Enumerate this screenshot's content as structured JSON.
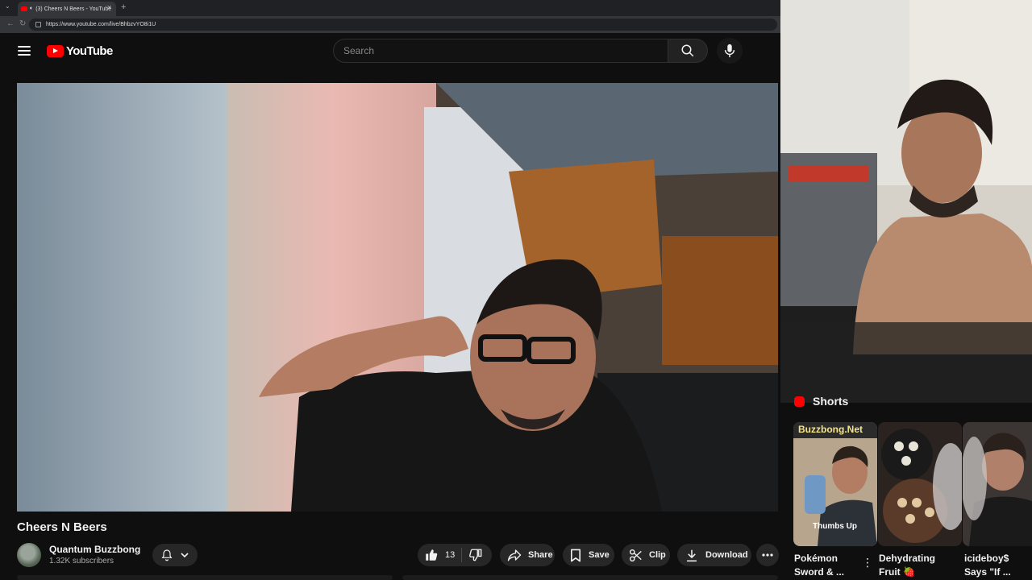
{
  "browser": {
    "tab_title": "(3) Cheers N Beers - YouTube",
    "url": "https://www.youtube.com/live/BhbzvYO8i1U"
  },
  "header": {
    "logo_text": "YouTube",
    "search_placeholder": "Search"
  },
  "video": {
    "title": "Cheers N Beers"
  },
  "channel": {
    "name": "Quantum Buzzbong",
    "subscribers": "1.32K subscribers"
  },
  "actions": {
    "like_count": "13",
    "share": "Share",
    "save": "Save",
    "clip": "Clip",
    "download": "Download"
  },
  "shorts": {
    "heading": "Shorts",
    "items": [
      {
        "overlay_top": "Buzzbong.Net",
        "overlay_bottom": "Thumbs Up",
        "title_line1": "Pokémon",
        "title_line2": "Sword & ..."
      },
      {
        "title_line1": "Dehydrating",
        "title_line2": "Fruit 🍓"
      },
      {
        "title_line1": "icideboy$",
        "title_line2": "Says \"If ..."
      }
    ]
  },
  "colors": {
    "brand_red": "#ff0000",
    "page_bg": "#0f0f0f",
    "pill_bg": "#272727"
  }
}
